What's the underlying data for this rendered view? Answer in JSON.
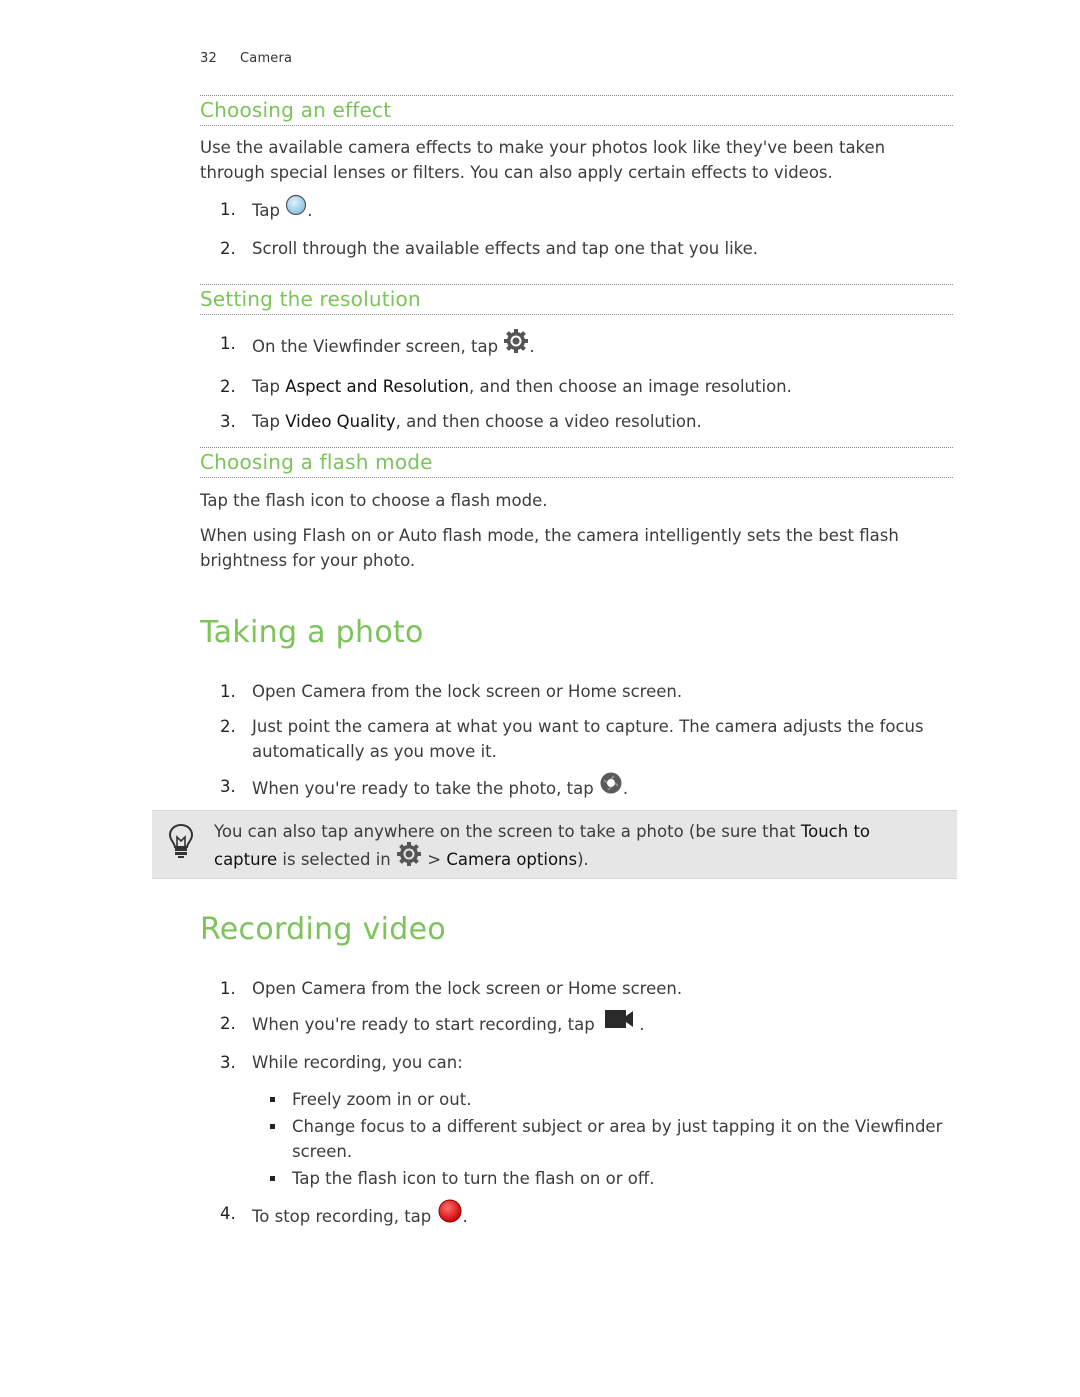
{
  "running_head": {
    "page_number": "32",
    "chapter": "Camera"
  },
  "choosing_effect": {
    "heading": "Choosing an effect",
    "intro": "Use the available camera effects to make your photos look like they've been taken through special lenses or filters. You can also apply certain effects to videos.",
    "steps": [
      {
        "num": "1.",
        "pre": "Tap ",
        "icon": "effects-icon",
        "post": "."
      },
      {
        "num": "2.",
        "text": "Scroll through the available effects and tap one that you like."
      }
    ]
  },
  "resolution": {
    "heading": "Setting the resolution",
    "steps": [
      {
        "num": "1.",
        "pre": "On the Viewfinder screen, tap ",
        "icon": "settings-gear-icon",
        "post": "."
      },
      {
        "num": "2.",
        "pre": "Tap ",
        "ui": "Aspect and Resolution",
        "post": ", and then choose an image resolution."
      },
      {
        "num": "3.",
        "pre": "Tap ",
        "ui": "Video Quality",
        "post": ", and then choose a video resolution."
      }
    ]
  },
  "flash": {
    "heading": "Choosing a flash mode",
    "para1": "Tap the flash icon to choose a flash mode.",
    "para2": "When using Flash on or Auto flash mode, the camera intelligently sets the best flash brightness for your photo."
  },
  "taking_photo": {
    "heading": "Taking a photo",
    "steps": [
      {
        "num": "1.",
        "text": "Open Camera from the lock screen or Home screen."
      },
      {
        "num": "2.",
        "text": "Just point the camera at what you want to capture. The camera adjusts the focus automatically as you move it."
      },
      {
        "num": "3.",
        "pre": "When you're ready to take the photo, tap ",
        "icon": "shutter-icon",
        "post": "."
      }
    ],
    "tip": {
      "icon": "lightbulb-icon",
      "pre": "You can also tap anywhere on the screen to take a photo (be sure that ",
      "ui1": "Touch to capture",
      "mid": " is selected in ",
      "icon2": "settings-gear-icon",
      "gt": " > ",
      "ui2": "Camera options",
      "post": ")."
    }
  },
  "recording_video": {
    "heading": "Recording video",
    "steps": [
      {
        "num": "1.",
        "text": "Open Camera from the lock screen or Home screen."
      },
      {
        "num": "2.",
        "pre": "When you're ready to start recording, tap ",
        "icon": "video-camera-icon",
        "post": "."
      },
      {
        "num": "3.",
        "text": "While recording, you can:"
      },
      {
        "num": "4.",
        "pre": "To stop recording, tap ",
        "icon": "stop-record-icon",
        "post": "."
      }
    ],
    "bullets": [
      "Freely zoom in or out.",
      "Change focus to a different subject or area by just tapping it on the Viewfinder screen.",
      "Tap the flash icon to turn the flash on or off."
    ]
  },
  "colors": {
    "heading_green": "#7cc35a",
    "tip_background": "#e6e6e6",
    "record_red": "#e01010"
  }
}
